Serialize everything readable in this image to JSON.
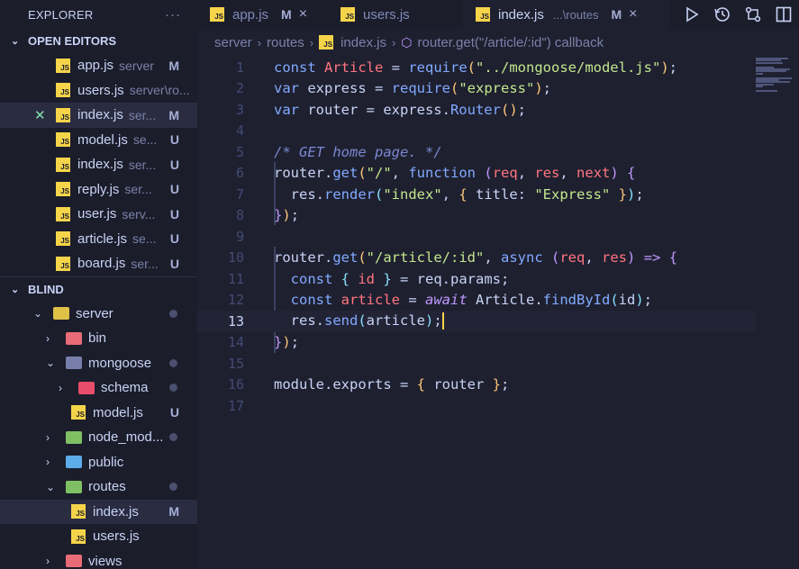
{
  "explorer": {
    "title": "EXPLORER",
    "more_icon": "ellipsis-icon",
    "open_editors": {
      "title": "OPEN EDITORS",
      "items": [
        {
          "name": "app.js",
          "dir": "server",
          "status": "M"
        },
        {
          "name": "users.js",
          "dir": "server\\ro...",
          "status": ""
        },
        {
          "name": "index.js",
          "dir": "ser...",
          "status": "M",
          "active": true
        },
        {
          "name": "model.js",
          "dir": "se...",
          "status": "U"
        },
        {
          "name": "index.js",
          "dir": "ser...",
          "status": "U"
        },
        {
          "name": "reply.js",
          "dir": "ser...",
          "status": "U"
        },
        {
          "name": "user.js",
          "dir": "serv...",
          "status": "U"
        },
        {
          "name": "article.js",
          "dir": "se...",
          "status": "U"
        },
        {
          "name": "board.js",
          "dir": "ser...",
          "status": "U"
        }
      ]
    },
    "workspace": {
      "title": "BLIND",
      "tree": [
        {
          "name": "server",
          "kind": "folder",
          "open": true,
          "depth": 0,
          "color": "#f5d44a",
          "dot": true
        },
        {
          "name": "bin",
          "kind": "folder",
          "open": false,
          "depth": 1,
          "color": "#ff757f"
        },
        {
          "name": "mongoose",
          "kind": "folder",
          "open": true,
          "depth": 1,
          "color": "#828bb8",
          "dot": true
        },
        {
          "name": "schema",
          "kind": "folder",
          "open": false,
          "depth": 2,
          "color": "#ff5370",
          "dot": true
        },
        {
          "name": "model.js",
          "kind": "file",
          "depth": 2,
          "status": "U"
        },
        {
          "name": "node_mod...",
          "kind": "folder",
          "open": false,
          "depth": 1,
          "color": "#8bd36b",
          "dot": true
        },
        {
          "name": "public",
          "kind": "folder",
          "open": false,
          "depth": 1,
          "color": "#65bcff"
        },
        {
          "name": "routes",
          "kind": "folder",
          "open": true,
          "depth": 1,
          "color": "#8bd36b",
          "dot": true
        },
        {
          "name": "index.js",
          "kind": "file",
          "depth": 2,
          "status": "M",
          "active": true
        },
        {
          "name": "users.js",
          "kind": "file",
          "depth": 2,
          "status": ""
        },
        {
          "name": "views",
          "kind": "folder",
          "open": false,
          "depth": 1,
          "color": "#ff757f"
        }
      ]
    }
  },
  "tabs": [
    {
      "name": "app.js",
      "status": "M",
      "close": "×"
    },
    {
      "name": "users.js"
    },
    {
      "name": "index.js",
      "dir": "...\\routes",
      "status": "M",
      "close": "×",
      "active": true
    }
  ],
  "toolbar_icons": [
    "run-icon",
    "history-icon",
    "compare-changes-icon",
    "split-editor-icon"
  ],
  "breadcrumb": [
    "server",
    "routes",
    "index.js",
    "router.get(\"/article/:id\") callback"
  ],
  "editor": {
    "current_line": 13,
    "lines": [
      {
        "n": "1",
        "tokens": [
          [
            "kw",
            "const "
          ],
          [
            "var",
            "Article"
          ],
          [
            "pn",
            " = "
          ],
          [
            "fn",
            "require"
          ],
          [
            "br1",
            "("
          ],
          [
            "str",
            "\"../mongoose/model.js\""
          ],
          [
            "br1",
            ")"
          ],
          [
            "pn",
            ";"
          ]
        ]
      },
      {
        "n": "2",
        "tokens": [
          [
            "kw",
            "var "
          ],
          [
            "pn",
            "express = "
          ],
          [
            "fn",
            "require"
          ],
          [
            "br1",
            "("
          ],
          [
            "str",
            "\"express\""
          ],
          [
            "br1",
            ")"
          ],
          [
            "pn",
            ";"
          ]
        ]
      },
      {
        "n": "3",
        "tokens": [
          [
            "kw",
            "var "
          ],
          [
            "pn",
            "router = express."
          ],
          [
            "fn",
            "Router"
          ],
          [
            "br1",
            "("
          ],
          [
            "br1",
            ")"
          ],
          [
            "pn",
            ";"
          ]
        ]
      },
      {
        "n": "4",
        "tokens": []
      },
      {
        "n": "5",
        "tokens": [
          [
            "cm",
            "/* GET home page. */"
          ]
        ]
      },
      {
        "n": "6",
        "tokens": [
          [
            "pn",
            "router."
          ],
          [
            "fn",
            "get"
          ],
          [
            "br1",
            "("
          ],
          [
            "str",
            "\"/\""
          ],
          [
            "pn",
            ", "
          ],
          [
            "kw",
            "function "
          ],
          [
            "br2",
            "("
          ],
          [
            "var",
            "req"
          ],
          [
            "pn",
            ", "
          ],
          [
            "var",
            "res"
          ],
          [
            "pn",
            ", "
          ],
          [
            "var",
            "next"
          ],
          [
            "br2",
            ")"
          ],
          [
            "pn",
            " "
          ],
          [
            "br2",
            "{"
          ]
        ]
      },
      {
        "n": "7",
        "tokens": [
          [
            "pn",
            "  res."
          ],
          [
            "fn",
            "render"
          ],
          [
            "br3",
            "("
          ],
          [
            "str",
            "\"index\""
          ],
          [
            "pn",
            ", "
          ],
          [
            "br1",
            "{ "
          ],
          [
            "pn",
            "title: "
          ],
          [
            "str",
            "\"Express\""
          ],
          [
            "br1",
            " }"
          ],
          [
            "br3",
            ")"
          ],
          [
            "pn",
            ";"
          ]
        ]
      },
      {
        "n": "8",
        "tokens": [
          [
            "br2",
            "}"
          ],
          [
            "br1",
            ")"
          ],
          [
            "pn",
            ";"
          ]
        ]
      },
      {
        "n": "9",
        "tokens": []
      },
      {
        "n": "10",
        "tokens": [
          [
            "pn",
            "router."
          ],
          [
            "fn",
            "get"
          ],
          [
            "br1",
            "("
          ],
          [
            "str",
            "\"/article/:id\""
          ],
          [
            "pn",
            ", "
          ],
          [
            "kw",
            "async "
          ],
          [
            "br2",
            "("
          ],
          [
            "var",
            "req"
          ],
          [
            "pn",
            ", "
          ],
          [
            "var",
            "res"
          ],
          [
            "br2",
            ")"
          ],
          [
            "kwp",
            " => "
          ],
          [
            "br2",
            "{"
          ]
        ]
      },
      {
        "n": "11",
        "tokens": [
          [
            "pn",
            "  "
          ],
          [
            "kw",
            "const "
          ],
          [
            "br3",
            "{ "
          ],
          [
            "var",
            "id"
          ],
          [
            "br3",
            " }"
          ],
          [
            "pn",
            " = req.params;"
          ]
        ]
      },
      {
        "n": "12",
        "tokens": [
          [
            "pn",
            "  "
          ],
          [
            "kw",
            "const "
          ],
          [
            "var",
            "article"
          ],
          [
            "pn",
            " = "
          ],
          [
            "kwp",
            "await "
          ],
          [
            "pn",
            "Article."
          ],
          [
            "fn",
            "findById"
          ],
          [
            "br3",
            "("
          ],
          [
            "pn",
            "id"
          ],
          [
            "br3",
            ")"
          ],
          [
            "pn",
            ";"
          ]
        ]
      },
      {
        "n": "13",
        "tokens": [
          [
            "pn",
            "  res."
          ],
          [
            "fn",
            "send"
          ],
          [
            "br3",
            "("
          ],
          [
            "pn",
            "article"
          ],
          [
            "br3",
            ")"
          ],
          [
            "pn",
            ";"
          ]
        ]
      },
      {
        "n": "14",
        "tokens": [
          [
            "br2",
            "}"
          ],
          [
            "br1",
            ")"
          ],
          [
            "pn",
            ";"
          ]
        ]
      },
      {
        "n": "15",
        "tokens": []
      },
      {
        "n": "16",
        "tokens": [
          [
            "pn",
            "module.exports = "
          ],
          [
            "br1",
            "{ "
          ],
          [
            "pn",
            "router "
          ],
          [
            "br1",
            "}"
          ],
          [
            "pn",
            ";"
          ]
        ]
      },
      {
        "n": "17",
        "tokens": []
      }
    ]
  }
}
